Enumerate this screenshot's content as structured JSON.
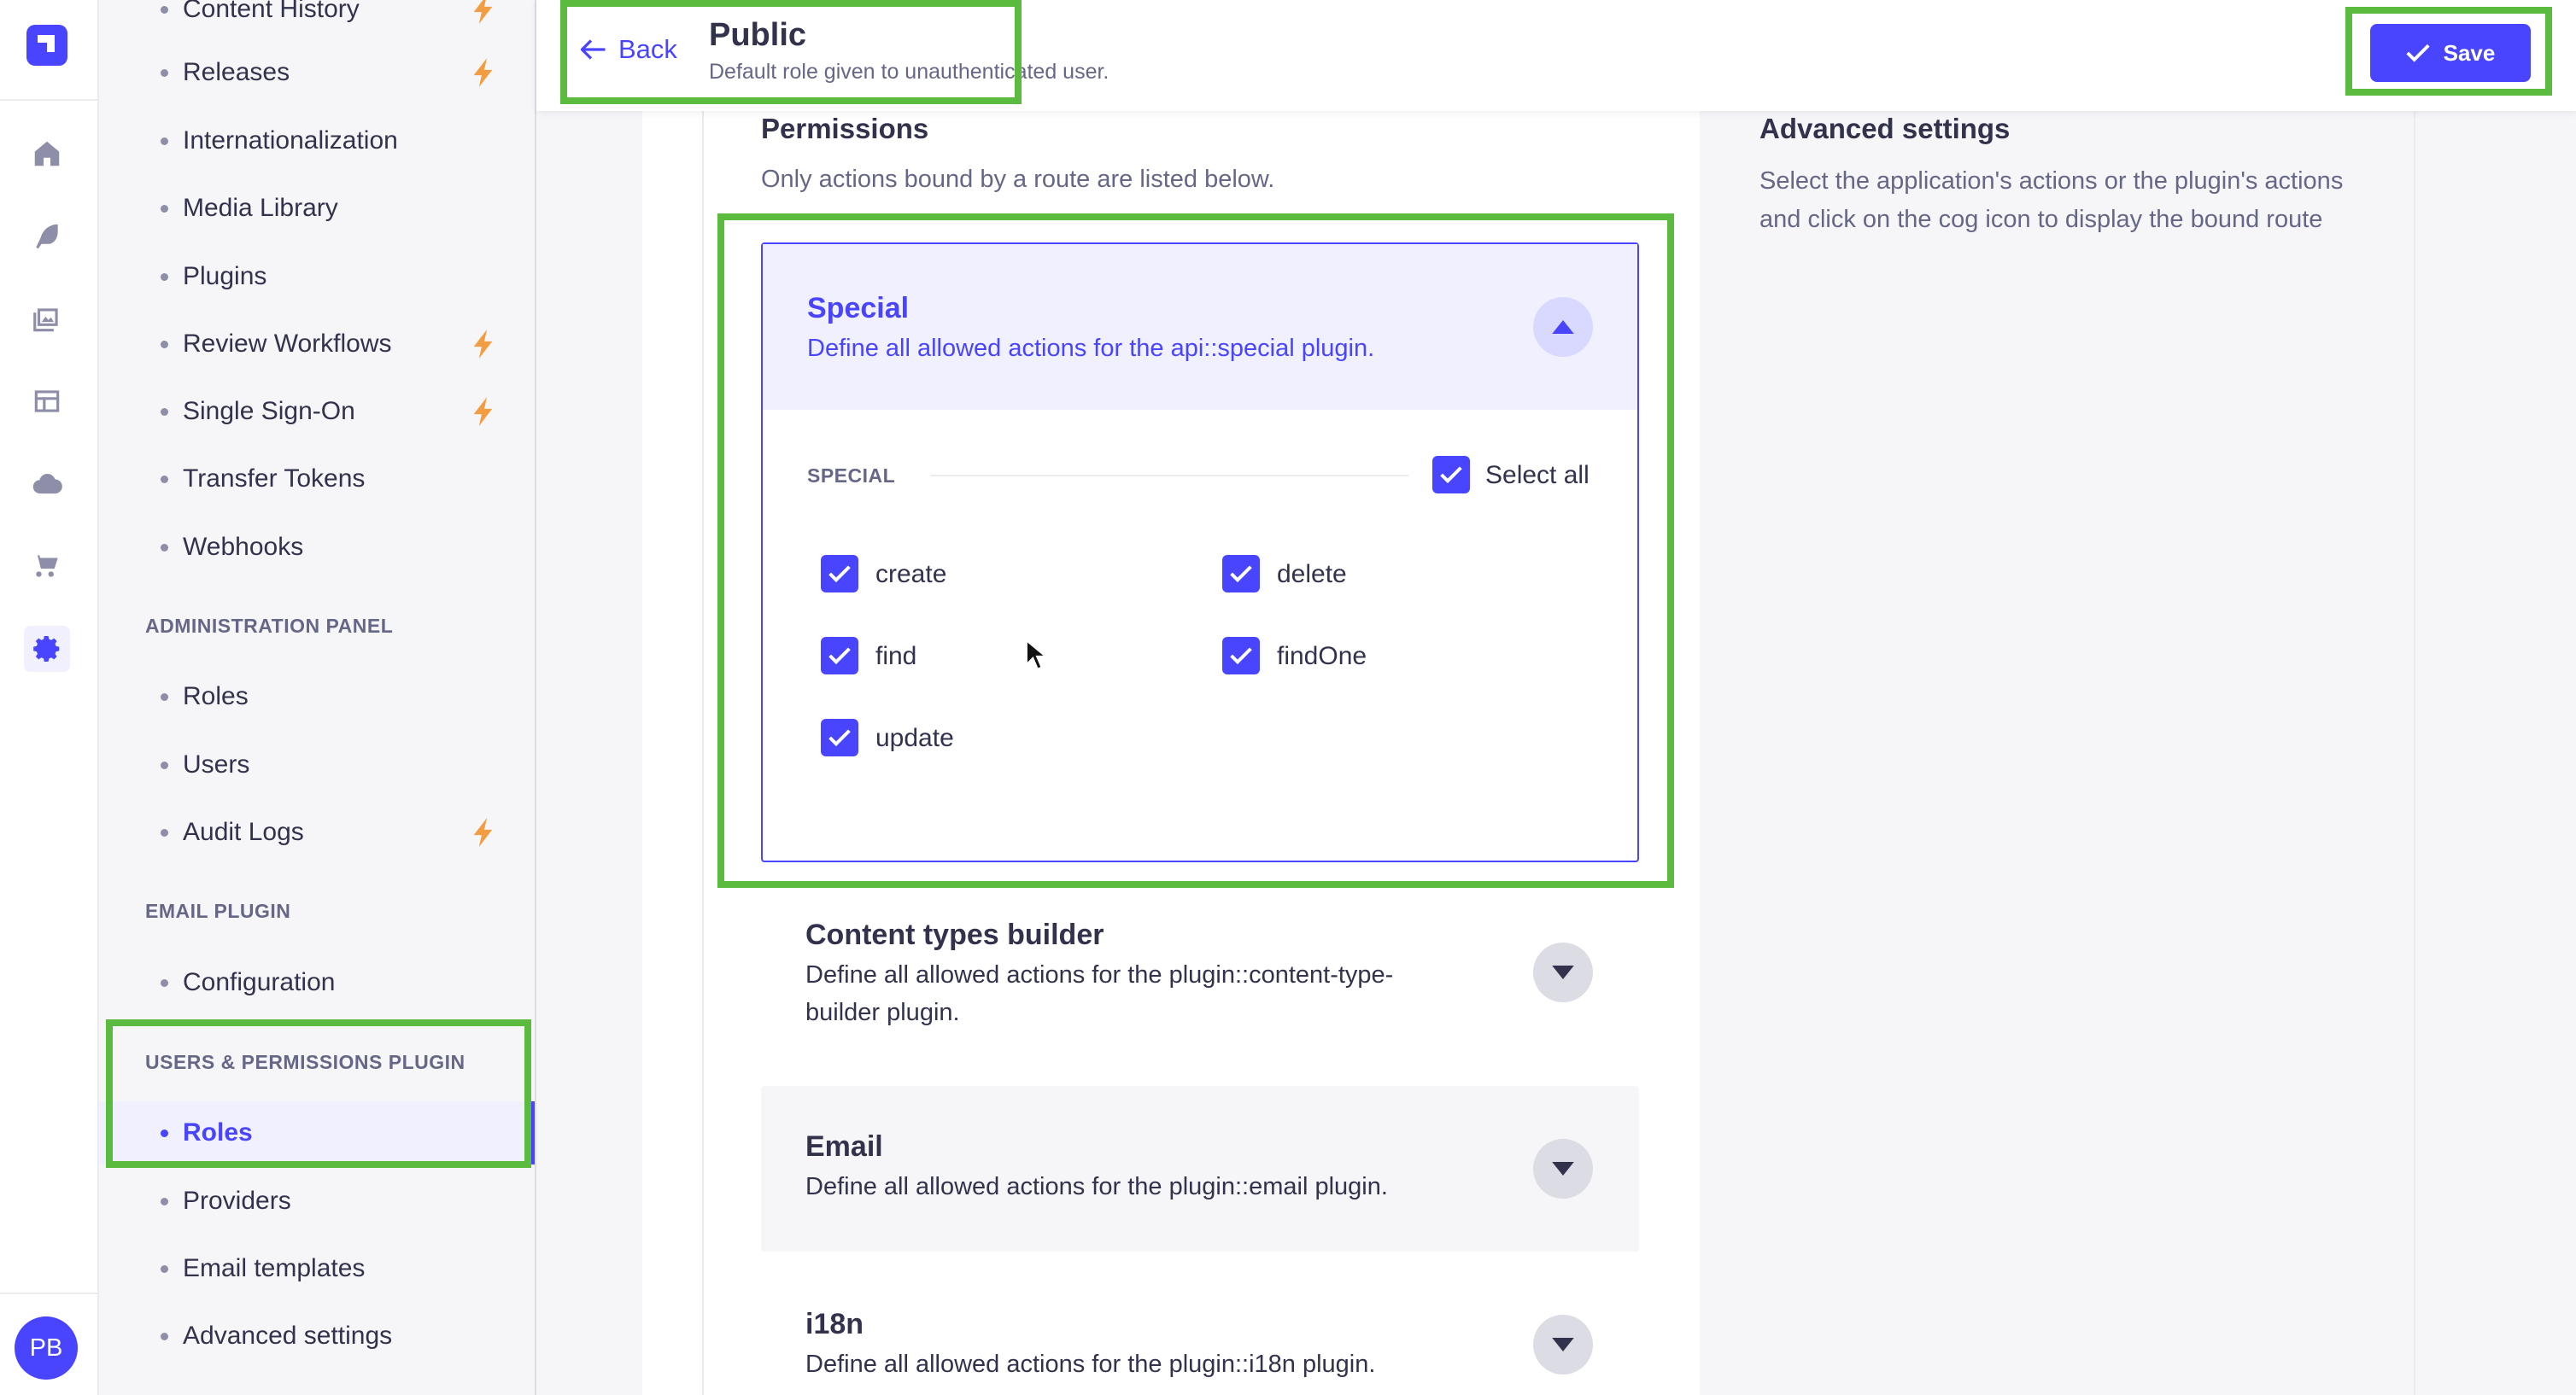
{
  "rail": {
    "logo": "strapi-logo-icon",
    "icons": [
      "home-icon",
      "feather-icon",
      "media-icon",
      "layout-icon",
      "cloud-icon",
      "cart-icon",
      "settings-icon"
    ],
    "avatar": "PB"
  },
  "subnav": {
    "items_top": [
      {
        "label": "Content History",
        "bolt": true
      },
      {
        "label": "Releases",
        "bolt": true
      },
      {
        "label": "Internationalization",
        "bolt": false
      },
      {
        "label": "Media Library",
        "bolt": false
      },
      {
        "label": "Plugins",
        "bolt": false
      },
      {
        "label": "Review Workflows",
        "bolt": true
      },
      {
        "label": "Single Sign-On",
        "bolt": true
      },
      {
        "label": "Transfer Tokens",
        "bolt": false
      },
      {
        "label": "Webhooks",
        "bolt": false
      }
    ],
    "admin_section": "ADMINISTRATION PANEL",
    "admin_items": [
      {
        "label": "Roles",
        "bolt": false
      },
      {
        "label": "Users",
        "bolt": false
      },
      {
        "label": "Audit Logs",
        "bolt": true
      }
    ],
    "email_section": "EMAIL PLUGIN",
    "email_items": [
      {
        "label": "Configuration"
      }
    ],
    "up_section": "USERS & PERMISSIONS PLUGIN",
    "up_items": [
      {
        "label": "Roles",
        "active": true
      },
      {
        "label": "Providers"
      },
      {
        "label": "Email templates"
      },
      {
        "label": "Advanced settings"
      }
    ]
  },
  "header": {
    "back_label": "Back",
    "title": "Public",
    "subtitle": "Default role given to unauthenticated user.",
    "save_label": "Save"
  },
  "permissions": {
    "title": "Permissions",
    "subtitle": "Only actions bound by a route are listed below."
  },
  "advanced": {
    "title": "Advanced settings",
    "description": "Select the application's actions or the plugin's actions and click on the cog icon to display the bound route"
  },
  "accordions": [
    {
      "title": "Special",
      "description": "Define all allowed actions for the api::special plugin.",
      "expanded": true,
      "section_label": "SPECIAL",
      "select_all_label": "Select all",
      "select_all_checked": true,
      "actions": [
        {
          "label": "create",
          "checked": true
        },
        {
          "label": "delete",
          "checked": true
        },
        {
          "label": "find",
          "checked": true
        },
        {
          "label": "findOne",
          "checked": true
        },
        {
          "label": "update",
          "checked": true
        }
      ]
    },
    {
      "title": "Content types builder",
      "description_line1": "Define all allowed actions for the plugin::content-type-",
      "description_line2": "builder plugin.",
      "expanded": false
    },
    {
      "title": "Email",
      "description": "Define all allowed actions for the plugin::email plugin.",
      "expanded": false
    },
    {
      "title": "i18n",
      "description": "Define all allowed actions for the plugin::i18n plugin.",
      "expanded": false
    }
  ],
  "colors": {
    "primary": "#4945ff",
    "highlight": "#5abb3e",
    "bolt": "#f29d41"
  }
}
